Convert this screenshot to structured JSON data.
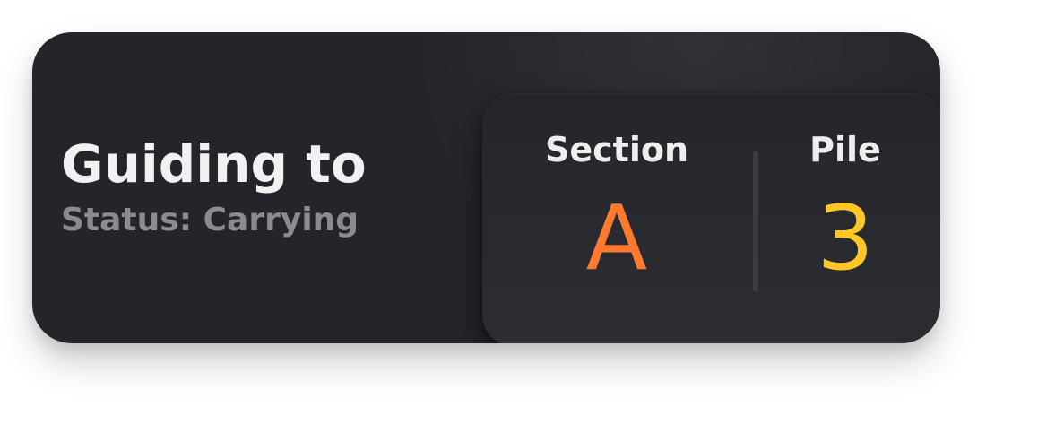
{
  "guidance": {
    "title": "Guiding to",
    "status": "Status: Carrying"
  },
  "destination": {
    "section_label": "Section",
    "section_value": "A",
    "pile_label": "Pile",
    "pile_value": "3"
  },
  "colors": {
    "section_value": "#ff7a2e",
    "pile_value": "#ffc726",
    "card_background": "#23252a",
    "panel_background": "#282a30"
  }
}
